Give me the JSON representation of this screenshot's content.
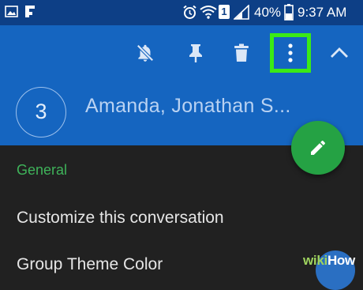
{
  "status_bar": {
    "battery_percent": "40%",
    "time": "9:37 AM",
    "sim_slot": "1",
    "icons": [
      "image-icon",
      "flipboard-icon",
      "alarm-icon",
      "wifi-icon",
      "sim-icon",
      "signal-icon",
      "battery-icon"
    ]
  },
  "toolbar": {
    "icons": [
      "notifications-off-icon",
      "pin-icon",
      "delete-icon",
      "more-options-icon",
      "collapse-icon"
    ],
    "highlight_color": "#3bea16"
  },
  "conversation": {
    "participant_count": "3",
    "title": "Amanda, Jonathan S..."
  },
  "fab": {
    "icon": "edit-pencil-icon",
    "color": "#25a244"
  },
  "settings": {
    "section_header": "General",
    "items": [
      "Customize this conversation",
      "Group Theme Color"
    ]
  },
  "watermark": {
    "wiki": "wiki",
    "how": "How"
  },
  "colors": {
    "status_bar": "#0d3f86",
    "app_bar": "#1565c0",
    "background": "#212121",
    "accent_green": "#3fb35a"
  }
}
